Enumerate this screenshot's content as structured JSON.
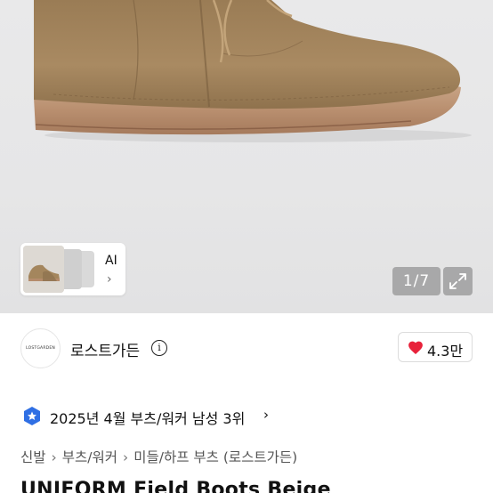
{
  "gallery": {
    "counter": "1/7",
    "thumb_label": "AI",
    "thumb_chevron": "›",
    "expand_icon": "expand-icon"
  },
  "seller": {
    "logo_text": "LOSTGARDEN",
    "name": "로스트가든",
    "info_icon": "i",
    "likes": "4.3만"
  },
  "ranking": {
    "text": "2025년 4월 부츠/워커 남성 3위",
    "chevron": "›"
  },
  "breadcrumb": [
    "신발",
    "부츠/워커",
    "미들/하프 부츠 (로스트가든)"
  ],
  "breadcrumb_sep": "›",
  "product": {
    "title": "UNIFORM Field Boots Beige"
  },
  "colors": {
    "heart": "#e8213a",
    "rank_badge": "#2f6fe4",
    "suede": "#a0825a"
  }
}
